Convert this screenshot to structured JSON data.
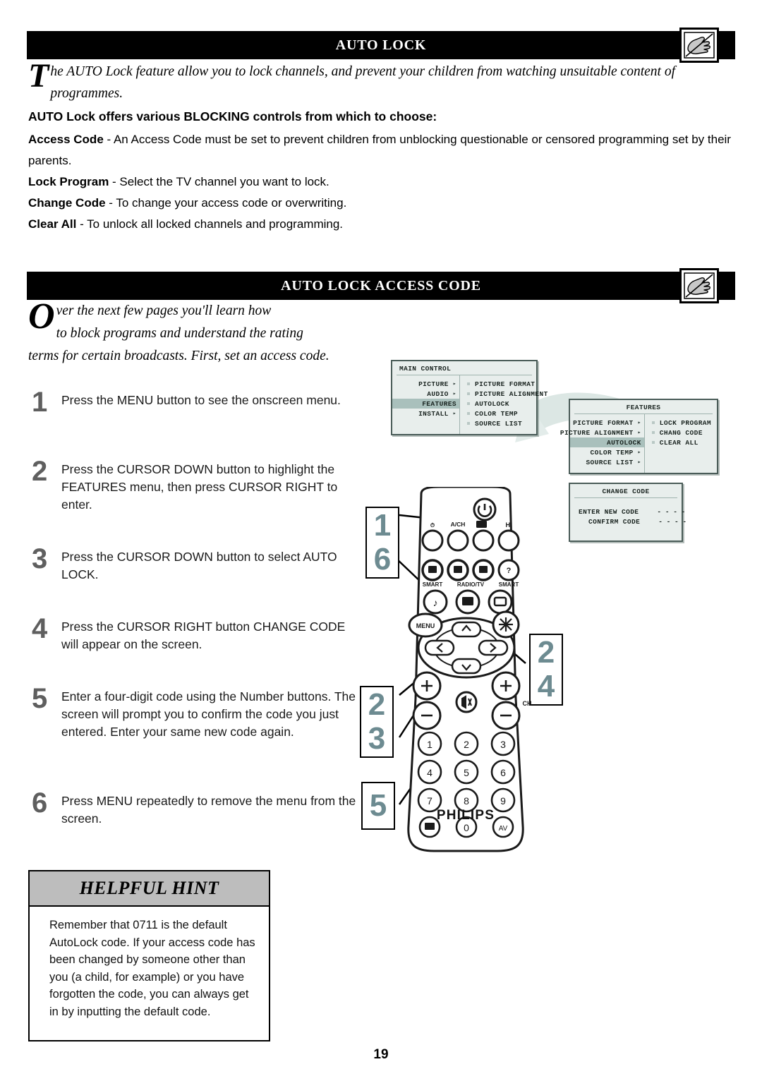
{
  "sections": [
    {
      "id": "auto-lock",
      "title_main": "A",
      "title": "AUTO LOCK",
      "icon": "hand-pointing-tv-icon"
    },
    {
      "id": "auto-lock-access-code",
      "title": "AUTO LOCK ACCESS CODE",
      "icon": "hand-pointing-tv-icon"
    }
  ],
  "intro1": {
    "dropcap": "T",
    "text": "he AUTO Lock feature allow you to lock channels, and prevent your children from watching unsuitable content of programmes."
  },
  "lead": "AUTO Lock offers various BLOCKING controls from which to choose:",
  "definitions": [
    {
      "term": "Access Code",
      "desc": " - An Access Code must be set to prevent children from unblocking questionable or censored programming set by their parents."
    },
    {
      "term": "Lock Program",
      "desc": " - Select the TV channel you want to lock."
    },
    {
      "term": "Change Code",
      "desc": " - To change your access code or overwriting."
    },
    {
      "term": "Clear All",
      "desc": " - To unlock all locked channels and programming."
    }
  ],
  "intro2": {
    "dropcap": "O",
    "line1": "ver the next few pages you'll learn how",
    "line2": "to block programs and understand the rating",
    "line3": "terms for certain broadcasts. First, set an access code."
  },
  "steps": [
    {
      "num": "1",
      "text": "Press the MENU  button to see the onscreen menu."
    },
    {
      "num": "2",
      "text": "Press the CURSOR DOWN button to highlight the FEATURES menu, then press CURSOR RIGHT to enter."
    },
    {
      "num": "3",
      "text": "Press the CURSOR DOWN button to select AUTO LOCK."
    },
    {
      "num": "4",
      "text": "Press the CURSOR RIGHT button CHANGE CODE will appear on the screen."
    },
    {
      "num": "5",
      "text": "Enter a four-digit code using the Number buttons. The screen will prompt you to confirm the code you just entered. Enter your same new code again."
    },
    {
      "num": "6",
      "text": "Press MENU repeatedly to remove the menu from the screen."
    }
  ],
  "osd": {
    "main_control": {
      "title": "MAIN CONTROL",
      "left_items": [
        {
          "label": "PICTURE",
          "arrow": true,
          "highlight": false
        },
        {
          "label": "AUDIO",
          "arrow": true,
          "highlight": false
        },
        {
          "label": "FEATURES",
          "arrow": false,
          "highlight": true
        },
        {
          "label": "INSTALL",
          "arrow": true,
          "highlight": false
        }
      ],
      "right_items": [
        {
          "label": "PICTURE FORMAT"
        },
        {
          "label": "PICTURE ALIGNMENT"
        },
        {
          "label": "AUTOLOCK"
        },
        {
          "label": "COLOR TEMP"
        },
        {
          "label": "SOURCE LIST"
        }
      ]
    },
    "features": {
      "title": "FEATURES",
      "left_items": [
        {
          "label": "PICTURE FORMAT",
          "arrow": true,
          "highlight": false
        },
        {
          "label": "PICTURE ALIGNMENT",
          "arrow": true,
          "highlight": false
        },
        {
          "label": "AUTOLOCK",
          "arrow": false,
          "highlight": true
        },
        {
          "label": "COLOR TEMP",
          "arrow": true,
          "highlight": false
        },
        {
          "label": "SOURCE LIST",
          "arrow": true,
          "highlight": false
        }
      ],
      "right_items": [
        {
          "label": "LOCK PROGRAM"
        },
        {
          "label": "CHANG CODE"
        },
        {
          "label": "CLEAR ALL"
        }
      ]
    },
    "change_code": {
      "title": "CHANGE CODE",
      "rows": [
        {
          "label": "ENTER NEW CODE",
          "value": "- - - -"
        },
        {
          "label": "CONFIRM CODE",
          "value": "- - - -"
        }
      ]
    }
  },
  "callouts": [
    {
      "id": "callout-1-6",
      "lines": [
        "1",
        "6"
      ]
    },
    {
      "id": "callout-2-3",
      "lines": [
        "2",
        "3"
      ]
    },
    {
      "id": "callout-5",
      "lines": [
        "5"
      ]
    },
    {
      "id": "callout-2-4",
      "lines": [
        "2",
        "4"
      ]
    }
  ],
  "remote": {
    "brand": "PHILIPS",
    "labels": {
      "a_ch": "A/CH",
      "hi": "HI",
      "smart_left": "SMART",
      "radio_tv": "RADIO/TV",
      "smart_right": "SMART",
      "menu": "MENU",
      "ch": "CH"
    },
    "keypad": [
      "1",
      "2",
      "3",
      "4",
      "5",
      "6",
      "7",
      "8",
      "9",
      "0"
    ],
    "av_label": "AV"
  },
  "hint": {
    "title_h": "H",
    "title_elpful": "ELPFUL",
    "title_h2": "H",
    "title_int": "INT",
    "title_full": "HELPFUL HINT",
    "body": "Remember that 0711 is the default AutoLock code. If your access code has been changed by someone other than you (a child, for example) or you have forgotten the code, you can always get in by inputting the default code."
  },
  "page_number": "19",
  "colors": {
    "callout_teal": "#6d8b91",
    "osd_bg": "#e8eeec",
    "osd_highlight": "#a9c0bc",
    "hint_header": "#bdbdbd",
    "step_num": "#5f5f5f"
  }
}
